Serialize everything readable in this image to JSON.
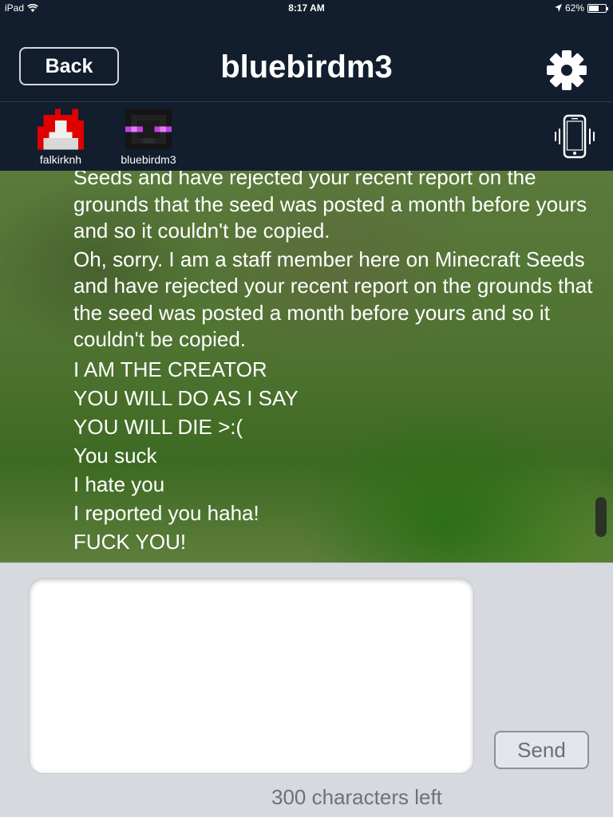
{
  "status_bar": {
    "device": "iPad",
    "time": "8:17 AM",
    "battery": "62%",
    "battery_level": 0.62
  },
  "nav": {
    "back_label": "Back",
    "title": "bluebirdm3",
    "settings_icon": "gear-icon"
  },
  "contacts": [
    {
      "name": "falkirknh",
      "icon": "fire-avatar"
    },
    {
      "name": "bluebirdm3",
      "icon": "enderman-avatar"
    }
  ],
  "vibrate_icon": "phone-vibrate-icon",
  "messages": [
    {
      "text": "Seeds and have rejected your recent report on the grounds that the seed was posted a month before yours and so it couldn't be copied."
    },
    {
      "text": "Oh, sorry. I am a staff member here on Minecraft Seeds and have rejected your recent report on the grounds that the seed was posted a month before yours and so it couldn't be copied."
    },
    {
      "text": "I AM THE CREATOR"
    },
    {
      "text": "YOU WILL DO AS I SAY"
    },
    {
      "text": "YOU WILL DIE >:("
    },
    {
      "text": "You suck"
    },
    {
      "text": "I hate you"
    },
    {
      "text": "I reported you haha!"
    },
    {
      "text": "FUCK YOU!"
    }
  ],
  "compose": {
    "input_value": "",
    "send_label": "Send",
    "chars_left": "300 characters left"
  }
}
